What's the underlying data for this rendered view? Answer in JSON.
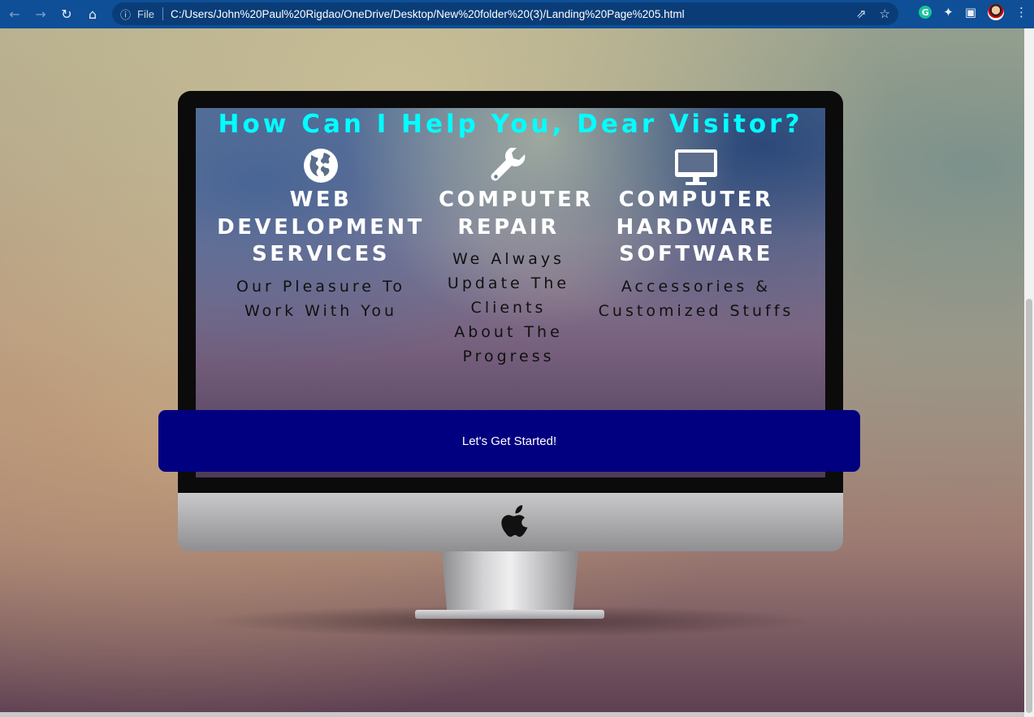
{
  "browser": {
    "back_icon": "←",
    "forward_icon": "→",
    "reload_icon": "↻",
    "home_icon": "⌂",
    "info_icon": "ⓘ",
    "file_label": "File",
    "url": "C:/Users/John%20Paul%20Rigdao/OneDrive/Desktop/New%20folder%20(3)/Landing%20Page%205.html",
    "share_icon": "⇗",
    "star_icon": "☆",
    "grammarly_letter": "G",
    "extensions_icon": "✦",
    "sidepanel_icon": "▣",
    "menu_icon": "⋮"
  },
  "page": {
    "headline": "How Can I Help You, Dear Visitor?",
    "services": [
      {
        "icon": "globe-icon",
        "title": "Web Development Services",
        "description": "Our Pleasure To Work With You"
      },
      {
        "icon": "wrench-icon",
        "title": "Computer Repair",
        "description": "We Always Update The Clients About The Progress"
      },
      {
        "icon": "monitor-icon",
        "title": "Computer Hardware Software",
        "description": "Accessories & Customized Stuffs"
      }
    ],
    "cta_label": "Let's Get Started!"
  },
  "colors": {
    "headline": "#00ffff",
    "cta_background": "#000080",
    "chrome_background": "#0f4f97"
  }
}
